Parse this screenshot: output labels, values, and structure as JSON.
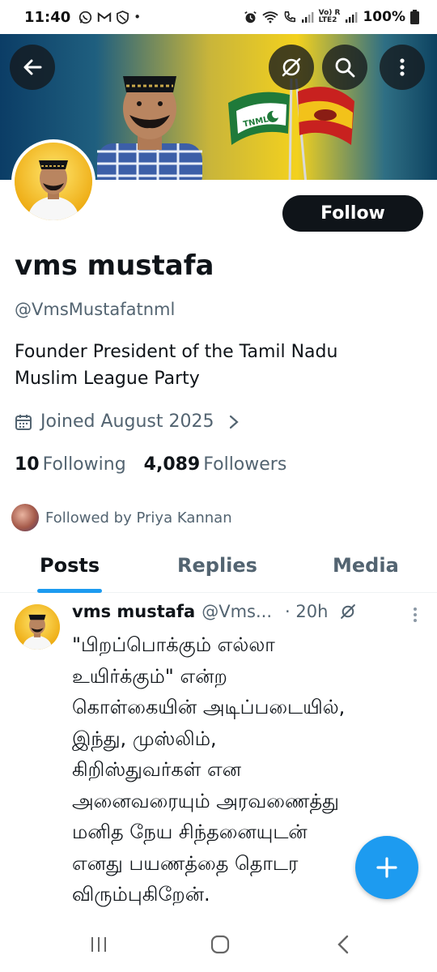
{
  "status_bar": {
    "time": "11:40",
    "network": "Vo) R\nLTE2",
    "battery": "100%"
  },
  "profile": {
    "display_name": "vms mustafa",
    "handle": "@VmsMustafatnml",
    "follow_label": "Follow",
    "bio": "Founder President of the Tamil Nadu\nMuslim League Party",
    "joined": "Joined August 2025",
    "following_count": "10",
    "following_label": "Following",
    "followers_count": "4,089",
    "followers_label": "Followers",
    "followed_by": "Followed by Priya Kannan",
    "banner_flag_text": "TNML"
  },
  "tabs": [
    {
      "label": "Posts",
      "active": true
    },
    {
      "label": "Replies",
      "active": false
    },
    {
      "label": "Media",
      "active": false
    }
  ],
  "tweet": {
    "name": "vms mustafa",
    "handle": "@Vms...",
    "time": "· 20h",
    "text": "\"பிறப்பொக்கும் எல்லா\nஉயிர்க்கும்\" என்ற\nகொள்கையின் அடிப்படையில்,\nஇந்து, முஸ்லிம்,\nகிறிஸ்துவர்கள் என\nஅனைவரையும் அரவணைத்து\nமனித நேய சிந்தனையுடன்\nஎனது பயணத்தை தொடர\nவிரும்புகிறேன்."
  },
  "colors": {
    "accent": "#1d9bf0",
    "text_primary": "#0f1419",
    "text_secondary": "#536471"
  },
  "icons": [
    "back-arrow-icon",
    "grok-icon",
    "search-icon",
    "more-vertical-icon",
    "calendar-icon",
    "chevron-right-icon",
    "plus-icon",
    "recents-icon",
    "home-icon",
    "nav-back-icon"
  ]
}
